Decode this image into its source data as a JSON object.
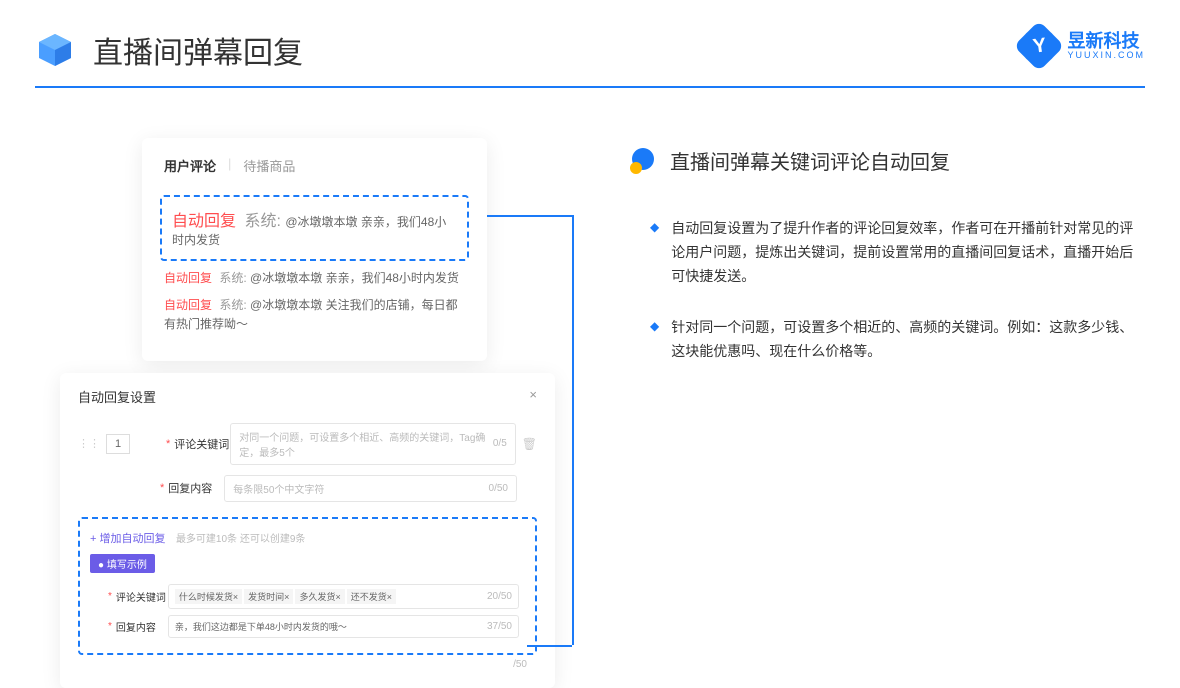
{
  "header": {
    "title": "直播间弹幕回复"
  },
  "brand": {
    "name": "昱新科技",
    "sub": "YUUXIN.COM",
    "glyph": "Y"
  },
  "comments": {
    "tab_active": "用户评论",
    "tab_inactive": "待播商品",
    "highlighted": {
      "tag": "自动回复",
      "sys": "系统:",
      "text": "@冰墩墩本墩 亲亲，我们48小时内发货"
    },
    "line2": {
      "tag": "自动回复",
      "sys": "系统:",
      "text": "@冰墩墩本墩 亲亲，我们48小时内发货"
    },
    "line3": {
      "tag": "自动回复",
      "sys": "系统:",
      "text": "@冰墩墩本墩 关注我们的店铺，每日都有热门推荐呦～"
    }
  },
  "settings": {
    "title": "自动回复设置",
    "close": "×",
    "num": "1",
    "kw_label": "评论关键词",
    "kw_placeholder": "对同一个问题，可设置多个相近、高频的关键词，Tag确定，最多5个",
    "kw_counter": "0/5",
    "content_label": "回复内容",
    "content_placeholder": "每条限50个中文字符",
    "content_counter": "0/50",
    "add_link": "+ 增加自动回复",
    "add_hint": "最多可建10条 还可以创建9条",
    "example_tag": "● 填写示例",
    "ex_kw_label": "评论关键词",
    "ex_tags": [
      "什么时候发货×",
      "发货时间×",
      "多久发货×",
      "还不发货×"
    ],
    "ex_kw_counter": "20/50",
    "ex_content_label": "回复内容",
    "ex_content_text": "亲，我们这边都是下单48小时内发货的哦～",
    "ex_content_counter": "37/50",
    "outer_counter": "/50"
  },
  "right": {
    "section_title": "直播间弹幕关键词评论自动回复",
    "bullet1": "自动回复设置为了提升作者的评论回复效率，作者可在开播前针对常见的评论用户问题，提炼出关键词，提前设置常用的直播间回复话术，直播开始后可快捷发送。",
    "bullet2": "针对同一个问题，可设置多个相近的、高频的关键词。例如：这款多少钱、这块能优惠吗、现在什么价格等。"
  }
}
